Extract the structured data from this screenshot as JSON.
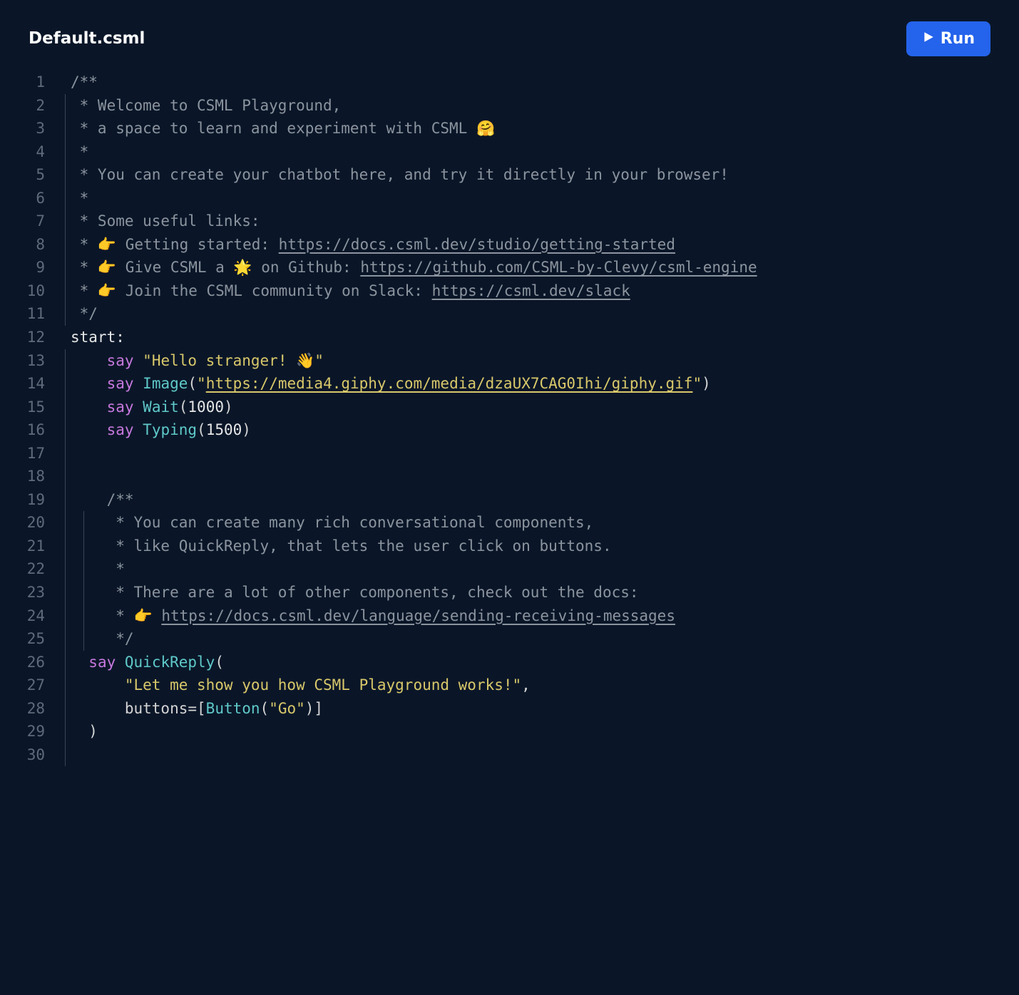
{
  "header": {
    "filename": "Default.csml",
    "run_label": "Run"
  },
  "lines": [
    {
      "n": "1",
      "indent": 0,
      "bars": [],
      "tokens": [
        {
          "cls": "tok-comment",
          "t": "/**"
        }
      ]
    },
    {
      "n": "2",
      "indent": 0,
      "bars": [
        0
      ],
      "tokens": [
        {
          "cls": "tok-comment",
          "t": " * Welcome to CSML Playground,"
        }
      ]
    },
    {
      "n": "3",
      "indent": 0,
      "bars": [
        0
      ],
      "tokens": [
        {
          "cls": "tok-comment",
          "t": " * a space to learn and experiment with CSML 🤗"
        }
      ]
    },
    {
      "n": "4",
      "indent": 0,
      "bars": [
        0
      ],
      "tokens": [
        {
          "cls": "tok-comment",
          "t": " *"
        }
      ]
    },
    {
      "n": "5",
      "indent": 0,
      "bars": [
        0
      ],
      "tokens": [
        {
          "cls": "tok-comment",
          "t": " * You can create your chatbot here, and try it directly in your browser!"
        }
      ]
    },
    {
      "n": "6",
      "indent": 0,
      "bars": [
        0
      ],
      "tokens": [
        {
          "cls": "tok-comment",
          "t": " *"
        }
      ]
    },
    {
      "n": "7",
      "indent": 0,
      "bars": [
        0
      ],
      "tokens": [
        {
          "cls": "tok-comment",
          "t": " * Some useful links:"
        }
      ]
    },
    {
      "n": "8",
      "indent": 0,
      "bars": [
        0
      ],
      "tokens": [
        {
          "cls": "tok-comment",
          "t": " * 👉 Getting started: "
        },
        {
          "cls": "tok-link",
          "t": "https://docs.csml.dev/studio/getting-started"
        }
      ]
    },
    {
      "n": "9",
      "indent": 0,
      "bars": [
        0
      ],
      "tokens": [
        {
          "cls": "tok-comment",
          "t": " * 👉 Give CSML a 🌟 on Github: "
        },
        {
          "cls": "tok-link",
          "t": "https://github.com/CSML-by-Clevy/csml-engine"
        }
      ]
    },
    {
      "n": "10",
      "indent": 0,
      "bars": [
        0
      ],
      "tokens": [
        {
          "cls": "tok-comment",
          "t": " * 👉 Join the CSML community on Slack: "
        },
        {
          "cls": "tok-link",
          "t": "https://csml.dev/slack"
        }
      ]
    },
    {
      "n": "11",
      "indent": 0,
      "bars": [
        0
      ],
      "tokens": [
        {
          "cls": "tok-comment",
          "t": " */"
        }
      ]
    },
    {
      "n": "12",
      "indent": 0,
      "bars": [],
      "tokens": [
        {
          "cls": "tok-label",
          "t": "start:"
        }
      ]
    },
    {
      "n": "13",
      "indent": 2,
      "bars": [
        0
      ],
      "tokens": [
        {
          "cls": "tok-keyword",
          "t": "say"
        },
        {
          "cls": "tok-punc",
          "t": " "
        },
        {
          "cls": "tok-string",
          "t": "\"Hello stranger! 👋\""
        }
      ]
    },
    {
      "n": "14",
      "indent": 2,
      "bars": [
        0
      ],
      "tokens": [
        {
          "cls": "tok-keyword",
          "t": "say"
        },
        {
          "cls": "tok-punc",
          "t": " "
        },
        {
          "cls": "tok-func",
          "t": "Image"
        },
        {
          "cls": "tok-punc",
          "t": "("
        },
        {
          "cls": "tok-string",
          "t": "\""
        },
        {
          "cls": "tok-linkstr",
          "t": "https://media4.giphy.com/media/dzaUX7CAG0Ihi/giphy.gif"
        },
        {
          "cls": "tok-string",
          "t": "\""
        },
        {
          "cls": "tok-punc",
          "t": ")"
        }
      ]
    },
    {
      "n": "15",
      "indent": 2,
      "bars": [
        0
      ],
      "tokens": [
        {
          "cls": "tok-keyword",
          "t": "say"
        },
        {
          "cls": "tok-punc",
          "t": " "
        },
        {
          "cls": "tok-func",
          "t": "Wait"
        },
        {
          "cls": "tok-punc",
          "t": "("
        },
        {
          "cls": "tok-number",
          "t": "1000"
        },
        {
          "cls": "tok-punc",
          "t": ")"
        }
      ]
    },
    {
      "n": "16",
      "indent": 2,
      "bars": [
        0
      ],
      "tokens": [
        {
          "cls": "tok-keyword",
          "t": "say"
        },
        {
          "cls": "tok-punc",
          "t": " "
        },
        {
          "cls": "tok-func",
          "t": "Typing"
        },
        {
          "cls": "tok-punc",
          "t": "("
        },
        {
          "cls": "tok-number",
          "t": "1500"
        },
        {
          "cls": "tok-punc",
          "t": ")"
        }
      ]
    },
    {
      "n": "17",
      "indent": 0,
      "bars": [
        0
      ],
      "tokens": []
    },
    {
      "n": "18",
      "indent": 0,
      "bars": [
        0
      ],
      "tokens": []
    },
    {
      "n": "19",
      "indent": 2,
      "bars": [
        0
      ],
      "tokens": [
        {
          "cls": "tok-comment",
          "t": "/**"
        }
      ]
    },
    {
      "n": "20",
      "indent": 2,
      "bars": [
        0,
        2
      ],
      "tokens": [
        {
          "cls": "tok-comment",
          "t": " * You can create many rich conversational components,"
        }
      ]
    },
    {
      "n": "21",
      "indent": 2,
      "bars": [
        0,
        2
      ],
      "tokens": [
        {
          "cls": "tok-comment",
          "t": " * like QuickReply, that lets the user click on buttons."
        }
      ]
    },
    {
      "n": "22",
      "indent": 2,
      "bars": [
        0,
        2
      ],
      "tokens": [
        {
          "cls": "tok-comment",
          "t": " *"
        }
      ]
    },
    {
      "n": "23",
      "indent": 2,
      "bars": [
        0,
        2
      ],
      "tokens": [
        {
          "cls": "tok-comment",
          "t": " * There are a lot of other components, check out the docs:"
        }
      ]
    },
    {
      "n": "24",
      "indent": 2,
      "bars": [
        0,
        2
      ],
      "tokens": [
        {
          "cls": "tok-comment",
          "t": " * 👉 "
        },
        {
          "cls": "tok-link",
          "t": "https://docs.csml.dev/language/sending-receiving-messages"
        }
      ]
    },
    {
      "n": "25",
      "indent": 2,
      "bars": [
        0,
        2
      ],
      "tokens": [
        {
          "cls": "tok-comment",
          "t": " */"
        }
      ]
    },
    {
      "n": "26",
      "indent": 1,
      "bars": [
        0
      ],
      "tokens": [
        {
          "cls": "tok-keyword",
          "t": "say"
        },
        {
          "cls": "tok-punc",
          "t": " "
        },
        {
          "cls": "tok-func",
          "t": "QuickReply"
        },
        {
          "cls": "tok-punc",
          "t": "("
        }
      ]
    },
    {
      "n": "27",
      "indent": 3,
      "bars": [
        0
      ],
      "tokens": [
        {
          "cls": "tok-string",
          "t": "\"Let me show you how CSML Playground works!\""
        },
        {
          "cls": "tok-punc",
          "t": ","
        }
      ]
    },
    {
      "n": "28",
      "indent": 3,
      "bars": [
        0
      ],
      "tokens": [
        {
          "cls": "tok-ident",
          "t": "buttons"
        },
        {
          "cls": "tok-punc",
          "t": "=["
        },
        {
          "cls": "tok-func",
          "t": "Button"
        },
        {
          "cls": "tok-punc",
          "t": "("
        },
        {
          "cls": "tok-string",
          "t": "\"Go\""
        },
        {
          "cls": "tok-punc",
          "t": ")]"
        }
      ]
    },
    {
      "n": "29",
      "indent": 1,
      "bars": [
        0
      ],
      "tokens": [
        {
          "cls": "tok-punc",
          "t": ")"
        }
      ]
    },
    {
      "n": "30",
      "indent": 0,
      "bars": [
        0
      ],
      "tokens": []
    }
  ]
}
